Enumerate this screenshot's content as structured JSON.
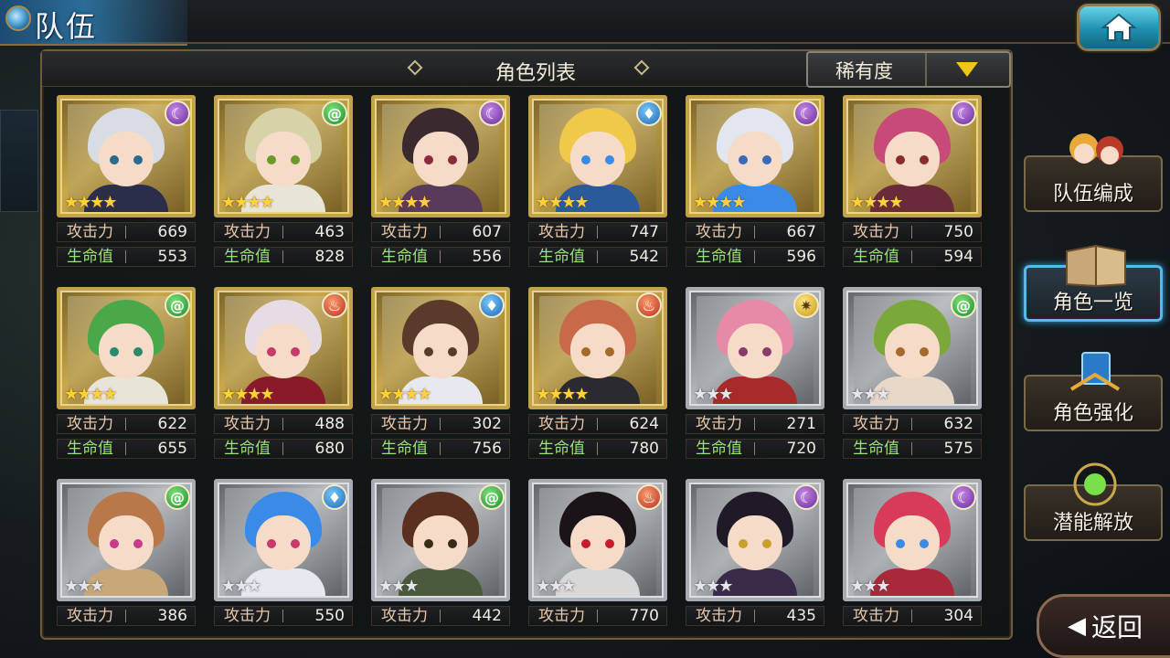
{
  "header": {
    "title": "队伍",
    "home_icon": "home-icon"
  },
  "panel": {
    "title": "角色列表",
    "sort_label": "稀有度",
    "sort_icon": "dropdown-arrow-icon"
  },
  "stat_labels": {
    "attack": "攻击力",
    "hp": "生命值"
  },
  "characters": [
    {
      "element": "dark",
      "element_glyph": "☾",
      "rarity": 4,
      "stars": "★★★★",
      "frame": "gold",
      "attack": "669",
      "hp": "553"
    },
    {
      "element": "wind",
      "element_glyph": "@",
      "rarity": 4,
      "stars": "★★★★",
      "frame": "gold",
      "attack": "463",
      "hp": "828"
    },
    {
      "element": "dark",
      "element_glyph": "☾",
      "rarity": 4,
      "stars": "★★★★",
      "frame": "gold",
      "attack": "607",
      "hp": "556"
    },
    {
      "element": "water",
      "element_glyph": "♦",
      "rarity": 4,
      "stars": "★★★★",
      "frame": "gold",
      "attack": "747",
      "hp": "542"
    },
    {
      "element": "dark",
      "element_glyph": "☾",
      "rarity": 4,
      "stars": "★★★★",
      "frame": "gold",
      "attack": "667",
      "hp": "596"
    },
    {
      "element": "dark",
      "element_glyph": "☾",
      "rarity": 4,
      "stars": "★★★★",
      "frame": "gold",
      "attack": "750",
      "hp": "594"
    },
    {
      "element": "wind",
      "element_glyph": "@",
      "rarity": 4,
      "stars": "★★★★",
      "frame": "gold",
      "attack": "622",
      "hp": "655"
    },
    {
      "element": "fire",
      "element_glyph": "♨",
      "rarity": 4,
      "stars": "★★★★",
      "frame": "gold",
      "attack": "488",
      "hp": "680"
    },
    {
      "element": "water",
      "element_glyph": "♦",
      "rarity": 4,
      "stars": "★★★★",
      "frame": "gold",
      "attack": "302",
      "hp": "756"
    },
    {
      "element": "fire",
      "element_glyph": "♨",
      "rarity": 4,
      "stars": "★★★★",
      "frame": "gold",
      "attack": "624",
      "hp": "780"
    },
    {
      "element": "light",
      "element_glyph": "✷",
      "rarity": 3,
      "stars": "★★★",
      "frame": "silver",
      "attack": "271",
      "hp": "720"
    },
    {
      "element": "wind",
      "element_glyph": "@",
      "rarity": 3,
      "stars": "★★★",
      "frame": "silver",
      "attack": "632",
      "hp": "575"
    },
    {
      "element": "wind",
      "element_glyph": "@",
      "rarity": 3,
      "stars": "★★★",
      "frame": "silver",
      "attack": "386",
      "hp": ""
    },
    {
      "element": "water",
      "element_glyph": "♦",
      "rarity": 3,
      "stars": "★★★",
      "frame": "silver",
      "attack": "550",
      "hp": ""
    },
    {
      "element": "wind",
      "element_glyph": "@",
      "rarity": 3,
      "stars": "★★★",
      "frame": "silver",
      "attack": "442",
      "hp": ""
    },
    {
      "element": "fire",
      "element_glyph": "♨",
      "rarity": 3,
      "stars": "★★★",
      "frame": "silver",
      "attack": "770",
      "hp": ""
    },
    {
      "element": "dark",
      "element_glyph": "☾",
      "rarity": 3,
      "stars": "★★★",
      "frame": "silver",
      "attack": "435",
      "hp": ""
    },
    {
      "element": "dark",
      "element_glyph": "☾",
      "rarity": 3,
      "stars": "★★★",
      "frame": "silver",
      "attack": "304",
      "hp": ""
    }
  ],
  "side_menu": [
    {
      "label": "队伍编成",
      "active": false
    },
    {
      "label": "角色一览",
      "active": true
    },
    {
      "label": "角色强化",
      "active": false
    },
    {
      "label": "潜能解放",
      "active": false
    }
  ],
  "back_button": {
    "label": "返回",
    "icon": "back-arrow-icon"
  },
  "colors": {
    "gold_frame": "#c4a24a",
    "silver_frame": "#a8acb2",
    "attack_label": "#e8c8a8",
    "hp_label": "#9ce07a",
    "active_accent": "#5ab8e8"
  }
}
